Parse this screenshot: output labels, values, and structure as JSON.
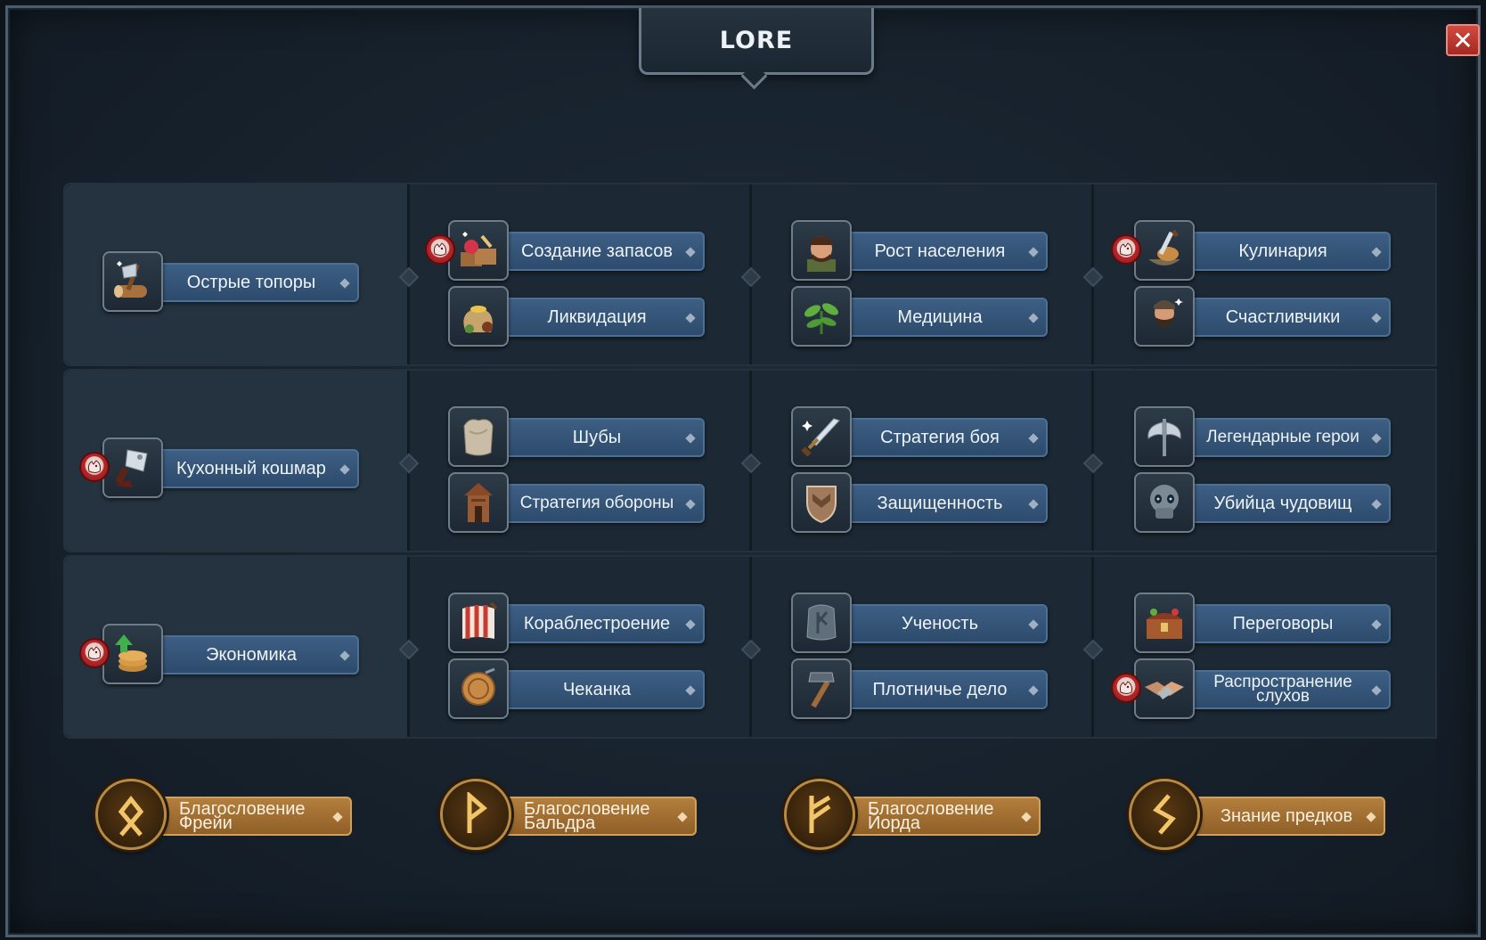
{
  "window": {
    "title": "LORE",
    "close_label": "✕"
  },
  "rows": [
    {
      "first": {
        "label": "Острые топоры",
        "icon": "axe-log-icon",
        "badge": false
      },
      "columns": [
        [
          {
            "label": "Создание запасов",
            "icon": "supplies-icon",
            "badge": true
          },
          {
            "label": "Ликвидация",
            "icon": "sack-icon",
            "badge": false
          }
        ],
        [
          {
            "label": "Рост населения",
            "icon": "villager-icon",
            "badge": false
          },
          {
            "label": "Медицина",
            "icon": "herb-icon",
            "badge": false
          }
        ],
        [
          {
            "label": "Кулинария",
            "icon": "cooking-icon",
            "badge": true
          },
          {
            "label": "Счастливчики",
            "icon": "bearded-viking-icon",
            "badge": false
          }
        ]
      ]
    },
    {
      "first": {
        "label": "Кухонный кошмар",
        "icon": "cleaver-icon",
        "badge": true
      },
      "columns": [
        [
          {
            "label": "Шубы",
            "icon": "fur-icon",
            "badge": false
          },
          {
            "label": "Стратегия обороны",
            "icon": "tower-icon",
            "badge": false
          }
        ],
        [
          {
            "label": "Стратегия боя",
            "icon": "sword-icon",
            "badge": false
          },
          {
            "label": "Защищенность",
            "icon": "shield-icon",
            "badge": false
          }
        ],
        [
          {
            "label": "Легендарные герои",
            "icon": "double-axe-icon",
            "badge": false
          },
          {
            "label": "Убийца чудовищ",
            "icon": "skull-icon",
            "badge": false
          }
        ]
      ]
    },
    {
      "first": {
        "label": "Экономика",
        "icon": "coins-up-icon",
        "badge": true
      },
      "columns": [
        [
          {
            "label": "Кораблестроение",
            "icon": "ship-sail-icon",
            "badge": false
          },
          {
            "label": "Чеканка",
            "icon": "coin-icon",
            "badge": false
          }
        ],
        [
          {
            "label": "Ученость",
            "icon": "runestone-icon",
            "badge": false
          },
          {
            "label": "Плотничье дело",
            "icon": "hammer-icon",
            "badge": false
          }
        ],
        [
          {
            "label": "Переговоры",
            "icon": "chest-icon",
            "badge": false
          },
          {
            "label": "Распространение слухов",
            "icon": "handshake-icon",
            "badge": true
          }
        ]
      ]
    }
  ],
  "blessings": [
    {
      "label": "Благословение Фрейи",
      "icon": "rune-othala-icon"
    },
    {
      "label": "Благословение Бальдра",
      "icon": "rune-wunjo-icon"
    },
    {
      "label": "Благословение Йорда",
      "icon": "rune-fehu-icon"
    },
    {
      "label": "Знание предков",
      "icon": "rune-sowilo-icon"
    }
  ],
  "colors": {
    "label_plate": "#35567a",
    "blessing_plate": "#a26f31",
    "badge": "#b8262a",
    "close": "#c23a30"
  }
}
